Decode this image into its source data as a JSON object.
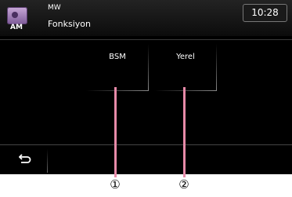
{
  "header": {
    "source_icon": "radio-icon",
    "source_icon_label": "AM",
    "band": "MW",
    "title": "Fonksiyon",
    "clock": "10:28"
  },
  "buttons": [
    {
      "label": "BSM"
    },
    {
      "label": "Yerel"
    }
  ],
  "back_button": {
    "icon": "return-arrow-icon"
  },
  "callouts": [
    "①",
    "②"
  ]
}
